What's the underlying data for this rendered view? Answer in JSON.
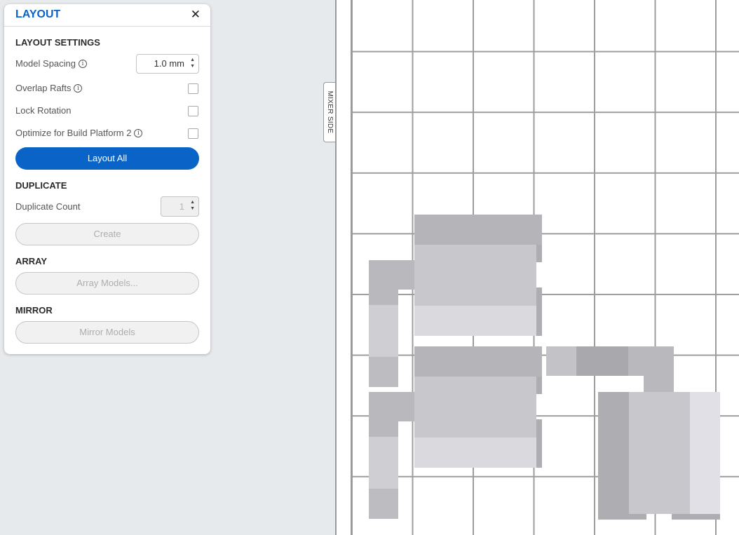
{
  "panel": {
    "title": "LAYOUT",
    "close_glyph": "✕",
    "layout_settings": {
      "heading": "LAYOUT SETTINGS",
      "model_spacing_label": "Model Spacing",
      "model_spacing_value": "1.0 mm",
      "overlap_rafts_label": "Overlap Rafts",
      "overlap_rafts_checked": false,
      "lock_rotation_label": "Lock Rotation",
      "lock_rotation_checked": false,
      "optimize_label": "Optimize for Build Platform 2",
      "optimize_checked": false,
      "layout_all_button": "Layout All"
    },
    "duplicate": {
      "heading": "DUPLICATE",
      "count_label": "Duplicate Count",
      "count_value": "1",
      "create_button": "Create"
    },
    "array": {
      "heading": "ARRAY",
      "button": "Array Models..."
    },
    "mirror": {
      "heading": "MIRROR",
      "button": "Mirror Models"
    }
  },
  "viewport": {
    "side_label": "MIXER SIDE"
  },
  "icons": {
    "info": "info-icon",
    "close": "close-icon",
    "stepper_arrows": "stepper-arrows-icon"
  },
  "colors": {
    "accent": "#0a64c8",
    "background": "#e7eaed",
    "grid": "#9d9d9d",
    "model_light": "#d8d8dc",
    "model_mid": "#c4c4c8",
    "model_dark": "#a9a9ae"
  }
}
